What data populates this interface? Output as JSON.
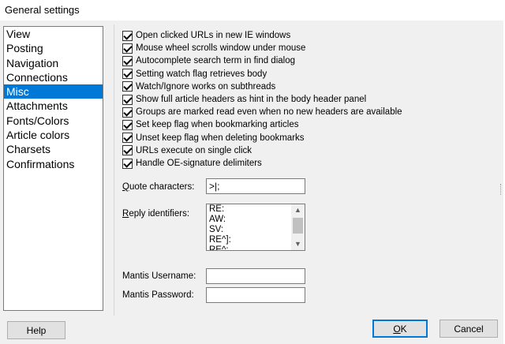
{
  "window": {
    "title": "General settings"
  },
  "nav": {
    "items": [
      "View",
      "Posting",
      "Navigation",
      "Connections",
      "Misc",
      "Attachments",
      "Fonts/Colors",
      "Article colors",
      "Charsets",
      "Confirmations"
    ],
    "selected": "Misc"
  },
  "options": {
    "items": [
      {
        "label": "Open clicked URLs in new IE windows",
        "checked": true
      },
      {
        "label": "Mouse wheel scrolls window under mouse",
        "checked": true
      },
      {
        "label": "Autocomplete search term in find dialog",
        "checked": true
      },
      {
        "label": "Setting watch flag retrieves body",
        "checked": true
      },
      {
        "label": "Watch/Ignore works on subthreads",
        "checked": true
      },
      {
        "label": "Show full article headers as hint in the body header panel",
        "checked": true
      },
      {
        "label": "Groups are marked read even when no new headers are available",
        "checked": true
      },
      {
        "label": "Set keep flag when bookmarking articles",
        "checked": true
      },
      {
        "label": "Unset keep flag when deleting bookmarks",
        "checked": true
      },
      {
        "label": "URLs execute on single click",
        "checked": true
      },
      {
        "label": "Handle OE-signature delimiters",
        "checked": true
      }
    ]
  },
  "quote": {
    "label_prefix": "Q",
    "label_rest": "uote characters:",
    "value": ">|;"
  },
  "reply": {
    "label_prefix": "R",
    "label_rest": "eply identifiers:",
    "items": [
      "RE:",
      "AW:",
      "SV:",
      "RE^]:",
      "RE^:"
    ]
  },
  "mantis": {
    "username_label": "Mantis Username:",
    "username_value": "",
    "password_label": "Mantis Password:",
    "password_value": ""
  },
  "buttons": {
    "help": "Help",
    "ok_prefix": "O",
    "ok_rest": "K",
    "cancel": "Cancel"
  },
  "icons": {
    "scroll_up": "▲",
    "scroll_down": "▼"
  },
  "colors": {
    "selection": "#0078d7"
  }
}
